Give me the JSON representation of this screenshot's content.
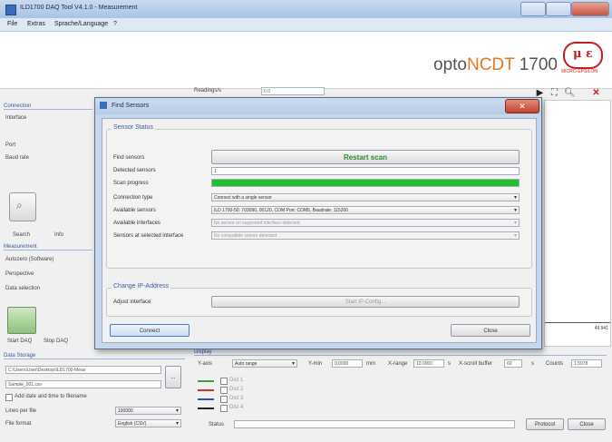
{
  "window": {
    "title": "ILD1700 DAQ Tool V4.1.0 - Measurement"
  },
  "menu": [
    "File",
    "Extras",
    "Sprache/Language",
    "?"
  ],
  "brand": {
    "prefix": "opto",
    "highlight": "NCDT",
    "model": " 1700",
    "logo": "μ ε",
    "logo_sub": "MICRO-EPSILON"
  },
  "readings": {
    "label": "Readings/s",
    "value": "0.0"
  },
  "left": {
    "connection_header": "Connection",
    "interface_label": "Interface",
    "port_label": "Port",
    "baud_label": "Baud rate",
    "search_label": "Search",
    "info_label": "Info",
    "measurement_header": "Measurement",
    "autozero_label": "Autozero (Software)",
    "perspective_label": "Perspective",
    "data_selection_label": "Data selection",
    "start_daq": "Start DAQ",
    "stop_daq": "Stop DAQ"
  },
  "chart": {
    "tick": "49.941"
  },
  "data_storage": {
    "header": "Data Storage",
    "path": "C:\\Users\\User\\Desktop\\ILD1700-Meas",
    "filename": "Sample_001.csv",
    "browse": "...",
    "add_date_label": "Add date and time to filename",
    "lines_label": "Lines per file",
    "lines_value": "100000",
    "format_label": "File format",
    "format_value": "English (CSV)"
  },
  "display": {
    "header": "Display",
    "yaxis_label": "Y-axis",
    "yaxis_value": "Auto range",
    "xmin_label": "Y-min",
    "xmin_value": "0.0000",
    "mm": "mm",
    "xrange_label": "X-range",
    "xrange_value": "10.0000",
    "s": "s",
    "scroll_label": "X-scroll buffer",
    "scroll_value": "60",
    "count_label": "Counts",
    "count_value": "1.5978",
    "channels": [
      "Dist 1",
      "Dist 2",
      "Dist 3",
      "Dist 4"
    ],
    "status_label": "Status"
  },
  "footer": {
    "protocol": "Protocol",
    "close": "Close"
  },
  "dialog": {
    "title": "Find Sensors",
    "sensor_status_header": "Sensor Status",
    "find_label": "Find sensors",
    "restart_button": "Restart scan",
    "detected_label": "Detected sensors",
    "detected_value": "1",
    "progress_label": "Scan progress",
    "progress_fraction": 1.0,
    "conn_type_label": "Connection type",
    "conn_type_value": "Connect with a single sensor",
    "available_sensors_label": "Available sensors",
    "available_sensors_value": "ILD 1700-50: 703090, 00120, COM Port: COM5, Baudrate: 115200",
    "available_if_label": "Available interfaces",
    "available_if_value": "No sensor on supported interface detected",
    "sensors_selected_label": "Sensors at selected interface",
    "sensors_selected_value": "No compatible sensor detected",
    "ip_header": "Change IP-Address",
    "adjust_label": "Adjust interface",
    "ip_button": "Start IP-Config...",
    "connect_button": "Connect",
    "close_button": "Close"
  }
}
